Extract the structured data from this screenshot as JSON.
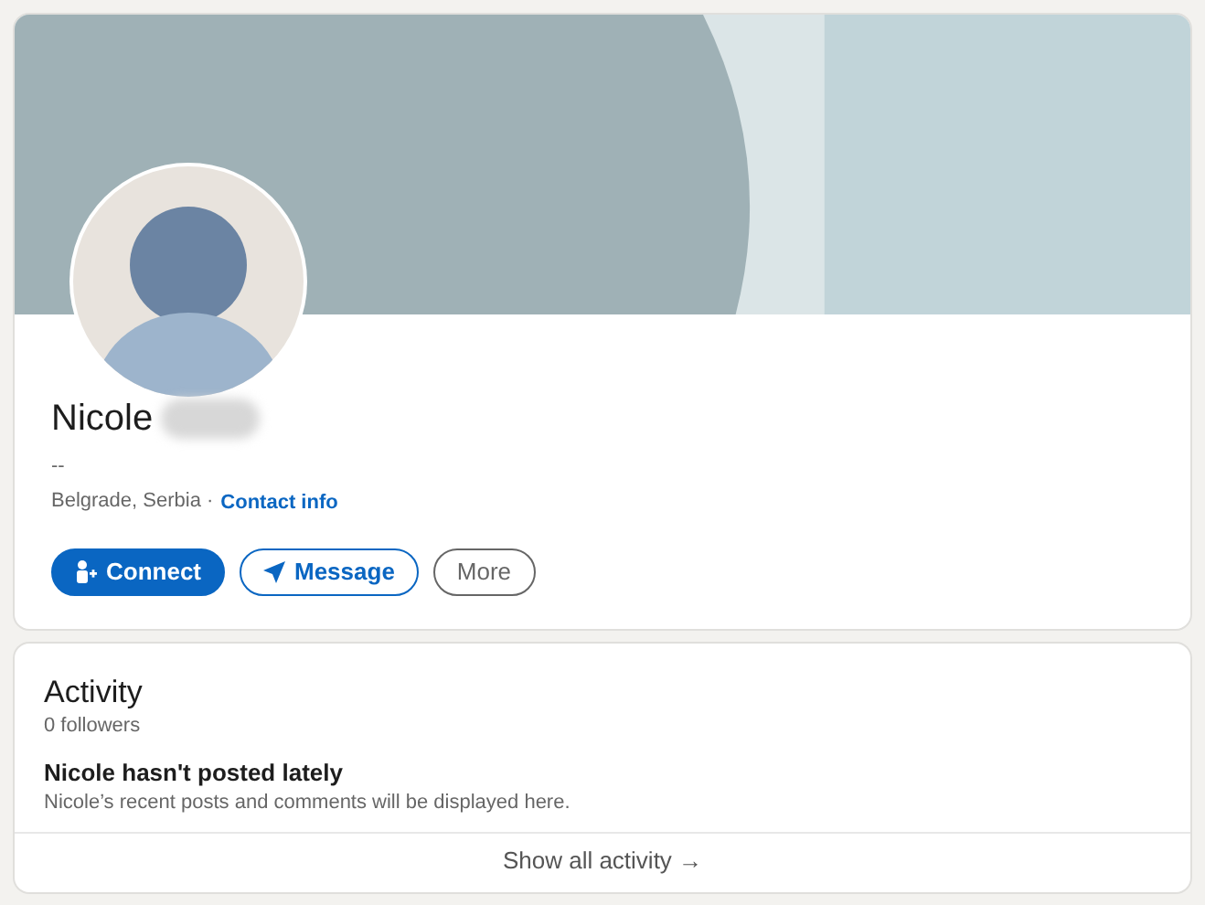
{
  "profile": {
    "name": "Nicole",
    "name_blurred": true,
    "headline": "--",
    "location": "Belgrade, Serbia ·",
    "contact_link": "Contact info",
    "buttons": [
      {
        "label": "Connect",
        "kind": "primary"
      },
      {
        "label": "Message",
        "kind": "outline"
      },
      {
        "label": "More",
        "kind": "secondary"
      }
    ]
  },
  "activity": {
    "title": "Activity",
    "followers": "0 followers",
    "empty_title": "Nicole hasn't posted lately",
    "empty_text": "Nicole’s recent posts and comments will be displayed here.",
    "footer_link": "Show all activity →"
  }
}
